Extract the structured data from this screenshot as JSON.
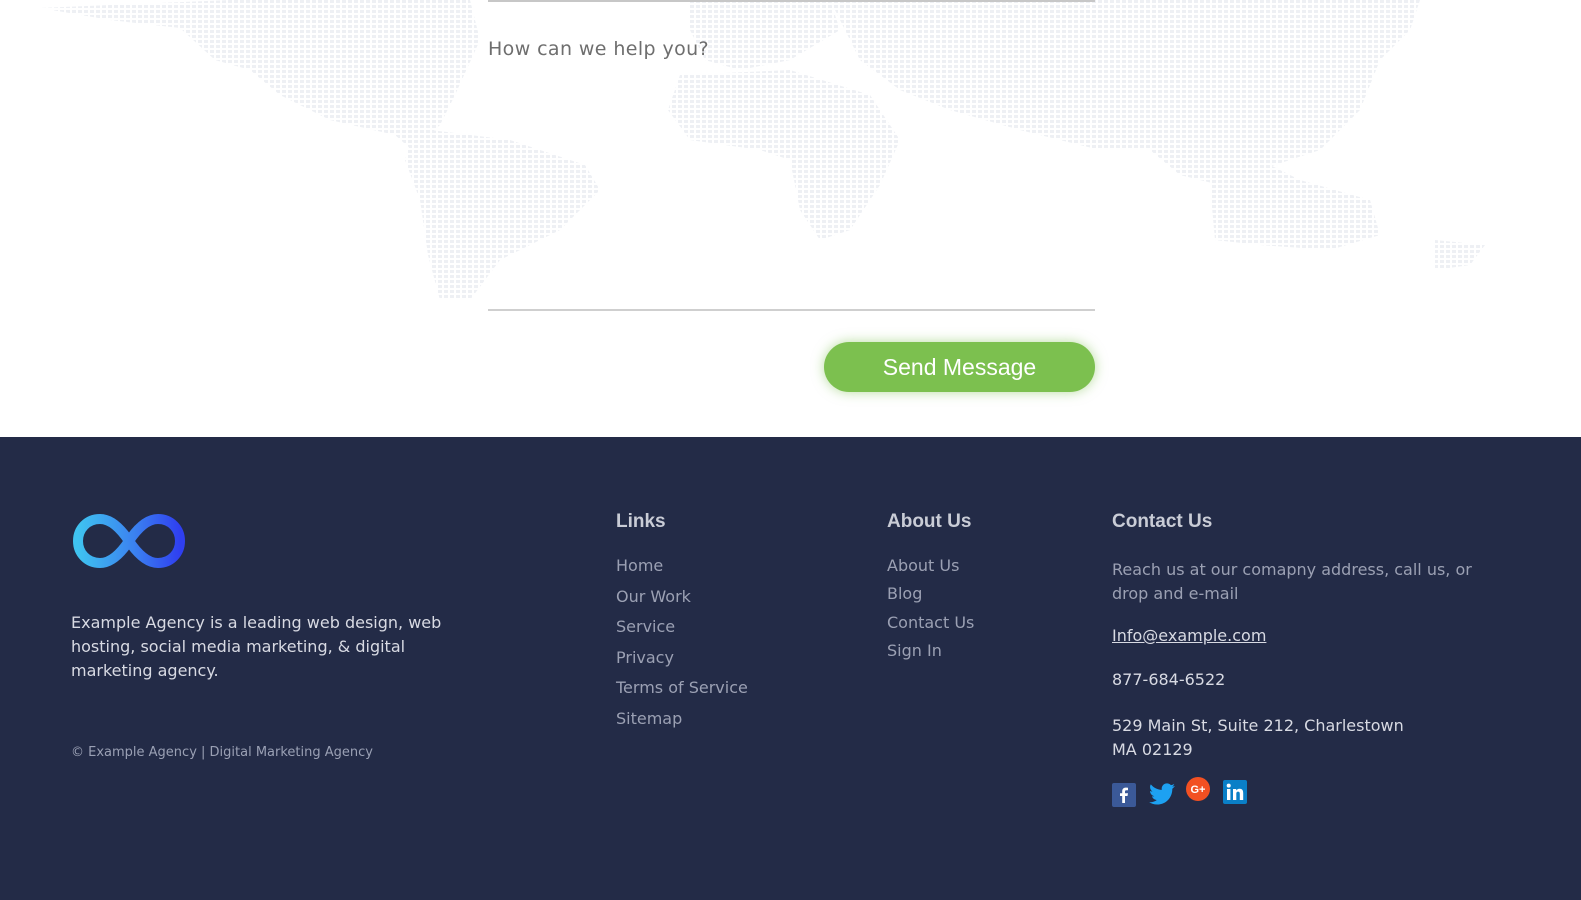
{
  "form": {
    "message_placeholder": "How can we help you?",
    "send_label": "Send Message",
    "accent_color": "#7cc04f"
  },
  "footer": {
    "background": "#232b47",
    "logo_icon": "infinity-logo-icon",
    "tagline": "Example Agency is a leading web design, web hosting, social media marketing, & digital marketing agency.",
    "copyright": "© Example Agency | Digital Marketing Agency",
    "links": {
      "heading": "Links",
      "items": [
        "Home",
        "Our Work",
        "Service",
        "Privacy",
        "Terms of Service",
        "Sitemap"
      ]
    },
    "about": {
      "heading": "About Us",
      "items": [
        "About Us",
        "Blog",
        "Contact Us",
        "Sign In"
      ]
    },
    "contact": {
      "heading": "Contact Us",
      "intro": "Reach us at our comapny address, call us, or drop and e-mail",
      "email": "Info@example.com",
      "phone": "877-684-6522",
      "address_line1": "529 Main St, Suite 212, Charlestown",
      "address_line2": "MA 02129"
    },
    "social": [
      {
        "icon": "facebook-icon",
        "color": "#3b5998"
      },
      {
        "icon": "twitter-icon",
        "color": "#1da1f2"
      },
      {
        "icon": "google-plus-icon",
        "color": "#f25022"
      },
      {
        "icon": "linkedin-icon",
        "color": "#0a7fc7"
      }
    ]
  }
}
